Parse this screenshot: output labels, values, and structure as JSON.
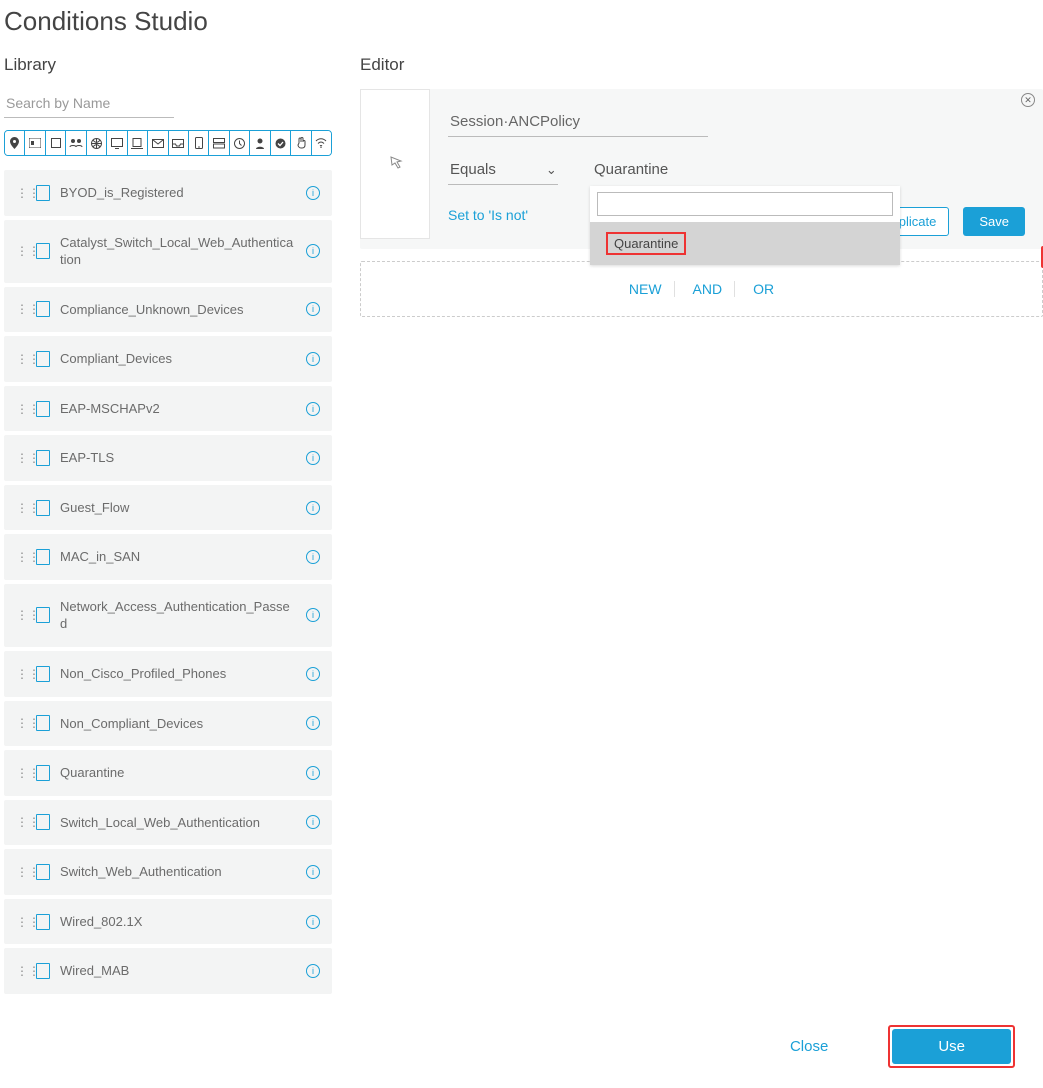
{
  "page_title": "Conditions Studio",
  "library": {
    "title": "Library",
    "search_placeholder": "Search by Name",
    "items": [
      {
        "name": "BYOD_is_Registered"
      },
      {
        "name": "Catalyst_Switch_Local_Web_Authentication"
      },
      {
        "name": "Compliance_Unknown_Devices"
      },
      {
        "name": "Compliant_Devices"
      },
      {
        "name": "EAP-MSCHAPv2"
      },
      {
        "name": "EAP-TLS"
      },
      {
        "name": "Guest_Flow"
      },
      {
        "name": "MAC_in_SAN"
      },
      {
        "name": "Network_Access_Authentication_Passed"
      },
      {
        "name": "Non_Cisco_Profiled_Phones"
      },
      {
        "name": "Non_Compliant_Devices"
      },
      {
        "name": "Quarantine"
      },
      {
        "name": "Switch_Local_Web_Authentication"
      },
      {
        "name": "Switch_Web_Authentication"
      },
      {
        "name": "Wired_802.1X"
      },
      {
        "name": "Wired_MAB"
      }
    ],
    "filter_icons": [
      "location-icon",
      "badge-icon",
      "square-icon",
      "group-icon",
      "globe-icon",
      "monitor-icon",
      "device-icon",
      "mail-icon",
      "inbox-icon",
      "phone-icon",
      "server-icon",
      "clock-icon",
      "person-icon",
      "shield-icon",
      "hand-icon",
      "wifi-icon"
    ]
  },
  "editor": {
    "title": "Editor",
    "attribute": "Session·ANCPolicy",
    "operator": "Equals",
    "value": "Quarantine",
    "set_link": "Set to 'Is not'",
    "buttons": {
      "duplicate": "Duplicate",
      "save": "Save"
    },
    "dropdown": {
      "search_value": "",
      "options": [
        "Quarantine"
      ]
    },
    "logic": {
      "new": "NEW",
      "and": "AND",
      "or": "OR"
    }
  },
  "footer": {
    "close": "Close",
    "use": "Use"
  }
}
